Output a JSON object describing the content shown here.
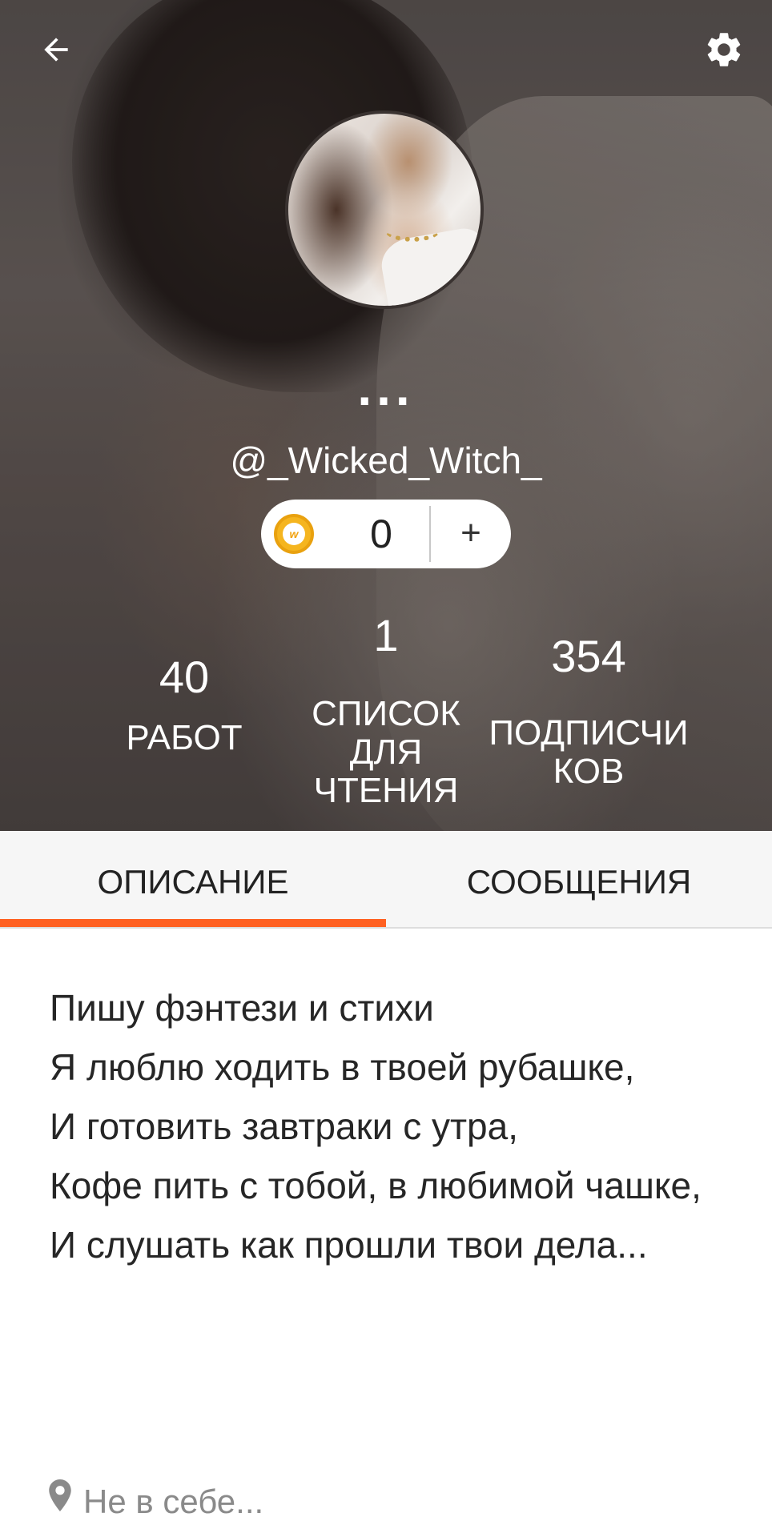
{
  "header": {
    "back_icon": "arrow-left-icon",
    "settings_icon": "gear-icon",
    "more_label": "...",
    "username": "@_Wicked_Witch_"
  },
  "coins": {
    "icon": "wattpad-coin-icon",
    "value": "0",
    "add_label": "+"
  },
  "stats": {
    "works": {
      "count": "40",
      "label": "работ"
    },
    "reading_lists": {
      "count": "1",
      "label": "список для чтения"
    },
    "followers": {
      "count": "354",
      "label": "подписчиков"
    }
  },
  "tabs": [
    {
      "label": "Описание",
      "active": true
    },
    {
      "label": "Сообщения",
      "active": false
    }
  ],
  "accent_color": "#ff6122",
  "about": {
    "lines": [
      "Пишу фэнтези и стихи",
      "Я люблю ходить в твоей рубашке,",
      "И готовить завтраки с утра,",
      "Кофе пить с тобой, в любимой чашке,",
      "И слушать как прошли твои дела..."
    ],
    "location_icon": "location-pin-icon",
    "location": "Не в себе..."
  }
}
